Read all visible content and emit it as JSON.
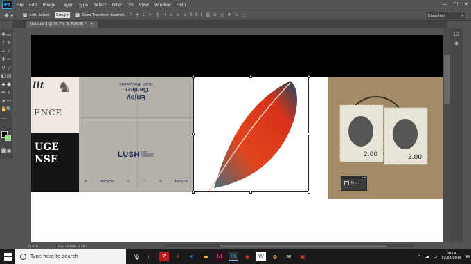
{
  "app": {
    "logo": "Ps"
  },
  "menu": [
    "File",
    "Edit",
    "Image",
    "Layer",
    "Type",
    "Select",
    "Filter",
    "3D",
    "View",
    "Window",
    "Help"
  ],
  "window_controls": [
    "—",
    "□",
    "✕"
  ],
  "options": {
    "auto_select_label": "Auto-Select:",
    "auto_select_checked": true,
    "auto_select_value": "Group",
    "show_transform_label": "Show Transform Controls",
    "show_transform_checked": true,
    "workspace": "Essentials"
  },
  "document": {
    "tab_title": "Untitled-1 @ 76.7% (5, RGB/8) *",
    "close": "×"
  },
  "canvas": {
    "left_image": {
      "top_text": "llt",
      "middle_text": "ENCE",
      "bottom_line1": "UGE",
      "bottom_line2": "NSE"
    },
    "box_image": {
      "line1": "Rush dheiyweos",
      "line2": "Genieze",
      "line3": "Enjoy",
      "brand": "LUSH",
      "brand_sub": "FRESH HANDMADE COSMETICS",
      "logos": [
        "♻",
        "Recycle",
        "♺",
        "♲",
        "♻",
        "Recycle"
      ]
    }
  },
  "mini_panel": {
    "label": "Pr..."
  },
  "status": {
    "zoom": "76.67%",
    "doc": "Doc: 24.9M/121.5M"
  },
  "taskbar": {
    "search_placeholder": "Type here to search",
    "clock_time": "00:04",
    "clock_date": "02/05/2018"
  },
  "colors": {
    "foreground": "#000000",
    "background": "#8fe07a",
    "accent": "#31a8ff"
  }
}
